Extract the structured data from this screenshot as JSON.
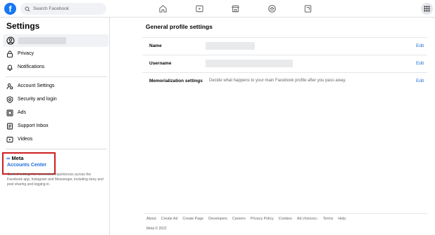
{
  "topbar": {
    "logo_letter": "f",
    "search_placeholder": "Search Facebook",
    "nav_icons": [
      "home-icon",
      "video-icon",
      "marketplace-icon",
      "groups-icon",
      "gaming-icon"
    ],
    "menu_icon": "grid-menu-icon"
  },
  "sidebar": {
    "title": "Settings",
    "items_top": [
      {
        "label": "Privacy",
        "icon": "lock-icon"
      },
      {
        "label": "Notifications",
        "icon": "bell-icon"
      }
    ],
    "items_bottom": [
      {
        "label": "Account Settings",
        "icon": "account-settings-icon"
      },
      {
        "label": "Security and login",
        "icon": "shield-icon"
      },
      {
        "label": "Ads",
        "icon": "ads-icon"
      },
      {
        "label": "Support Inbox",
        "icon": "support-inbox-icon"
      },
      {
        "label": "Videos",
        "icon": "videos-icon"
      }
    ],
    "meta_label": "Meta",
    "accounts_center": "Accounts Center",
    "accounts_desc": "Control settings for connected experiences across the Facebook app, Instagram and Messenger, including story and post sharing and logging in."
  },
  "main": {
    "title": "General profile settings",
    "fields": [
      {
        "label": "Name",
        "description": "",
        "edit": "Edit"
      },
      {
        "label": "Username",
        "description": "",
        "edit": "Edit"
      },
      {
        "label": "Memorialization settings",
        "description": "Decide what happens to your main Facebook profile after you pass away.",
        "edit": "Edit"
      }
    ],
    "footer_links": [
      "About",
      "Create Ad",
      "Create Page",
      "Developers",
      "Careers",
      "Privacy Policy",
      "Cookies",
      "Ad choices",
      "Terms",
      "Help"
    ],
    "copyright": "Meta © 2022"
  },
  "colors": {
    "brand_blue": "#1877f2",
    "link_blue": "#216fdb",
    "highlight_red": "#cc1f1f"
  }
}
